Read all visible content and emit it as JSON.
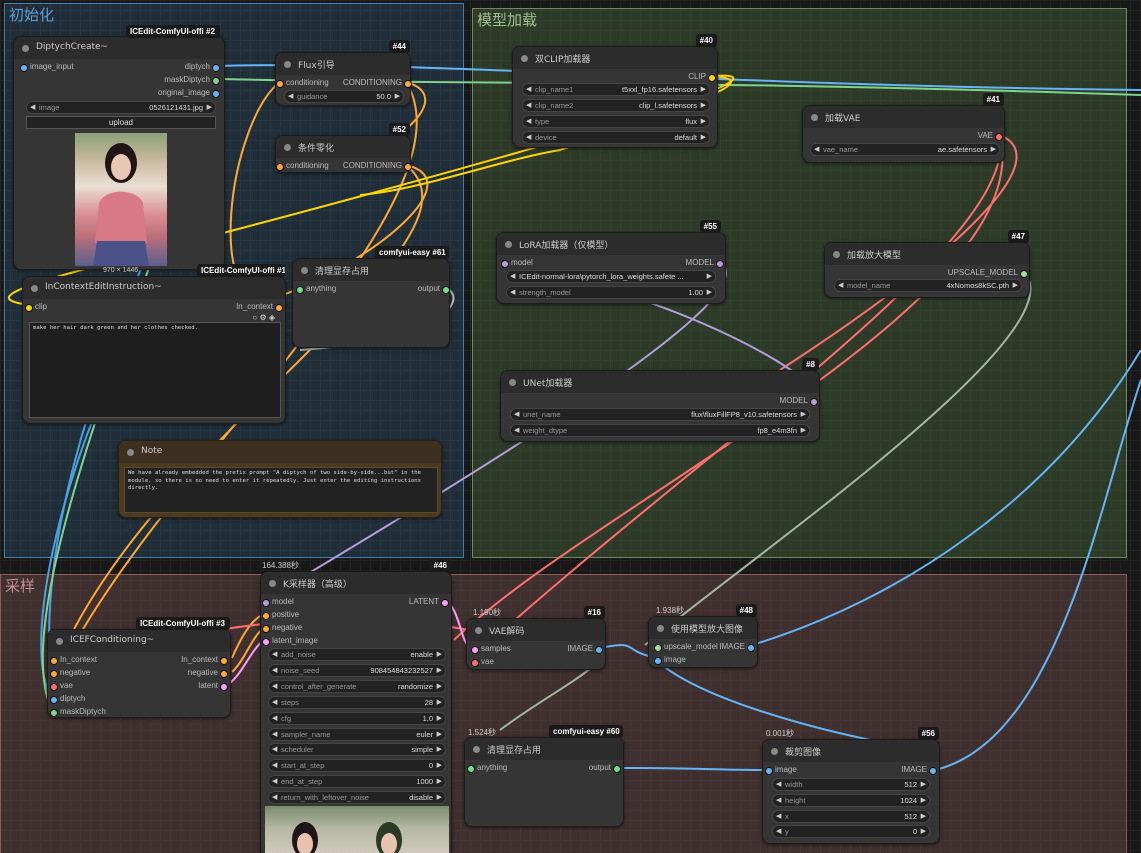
{
  "groups": {
    "init": {
      "title": "初始化",
      "color": "#3f7fb0",
      "bg": "rgba(50,90,120,0.35)"
    },
    "model": {
      "title": "模型加载",
      "color": "#6d8c5c",
      "bg": "rgba(70,100,60,0.45)"
    },
    "sample": {
      "title": "采样",
      "color": "#8c5a5a",
      "bg": "rgba(110,75,75,0.45)"
    }
  },
  "colors": {
    "conditioning": "#ffa931",
    "clip": "#ffd500",
    "model": "#b39ddb",
    "vae": "#ff6e6e",
    "image": "#64b5f6",
    "latent": "#ff9cf9",
    "any": "#aaaaaa"
  },
  "nodes": {
    "diptych": {
      "title": "DiptychCreate~",
      "badge": "ICEdit-ComfyUI-offi",
      "id": "#2",
      "in_image": "image_input",
      "out_diptych": "diptych",
      "out_mask": "maskDiptych",
      "out_original": "original_image",
      "image_label": "image",
      "image_value": "0526121431.jpg",
      "upload": "upload",
      "dims": "970 × 1446"
    },
    "flux": {
      "title": "Flux引导",
      "id": "#44",
      "in_cond": "conditioning",
      "out_cond": "CONDITIONING",
      "guidance_label": "guidance",
      "guidance_value": "50.0"
    },
    "zero": {
      "title": "条件零化",
      "id": "#52",
      "in_cond": "conditioning",
      "out_cond": "CONDITIONING"
    },
    "clear1": {
      "title": "清理显存占用",
      "badge": "comfyui-easy",
      "id": "#61",
      "in_any": "anything",
      "out": "output"
    },
    "iceinst": {
      "title": "InContextEditInstruction~",
      "badge": "ICEdit-ComfyUI-offi",
      "id": "#1",
      "in_clip": "clip",
      "out_ctx": "In_context",
      "prompt": "make her hair dark green and her clothes checked."
    },
    "note": {
      "title": "Note",
      "text": "We have already embedded the prefix prompt  \"A diptych of two side-by-side...but\"  in the module, so there is no need to enter it repeatedly. Just enter the editing instructions directly."
    },
    "dualclip": {
      "title": "双CLIP加载器",
      "id": "#40",
      "out_clip": "CLIP",
      "clip1_label": "clip_name1",
      "clip1_value": "t5xxl_fp16.safetensors",
      "clip2_label": "clip_name2",
      "clip2_value": "clip_l.safetensors",
      "type_label": "type",
      "type_value": "flux",
      "device_label": "device",
      "device_value": "default"
    },
    "vaeload": {
      "title": "加载VAE",
      "id": "#41",
      "out_vae": "VAE",
      "name_label": "vae_name",
      "name_value": "ae.safetensors"
    },
    "lora": {
      "title": "LoRA加载器（仅模型）",
      "id": "#55",
      "in_model": "model",
      "out_model": "MODEL",
      "lora_value": "ICEdit-normal-lora\\pytorch_lora_weights.safete ...",
      "strength_label": "strength_model",
      "strength_value": "1.00"
    },
    "upmodel": {
      "title": "加载放大模型",
      "id": "#47",
      "out": "UPSCALE_MODEL",
      "name_label": "model_name",
      "name_value": "4xNomos8kSC.pth"
    },
    "unet": {
      "title": "UNet加载器",
      "id": "#8",
      "out_model": "MODEL",
      "name_label": "unet_name",
      "name_value": "flux\\fluxFillFP8_v10.safetensors",
      "dtype_label": "weight_dtype",
      "dtype_value": "fp8_e4m3fn"
    },
    "ksampler": {
      "title": "K采样器（高级）",
      "id": "#46",
      "time": "164.388秒",
      "in_model": "model",
      "in_pos": "positive",
      "in_neg": "negative",
      "in_latent": "latent_image",
      "out_latent": "LATENT",
      "widgets": [
        {
          "label": "add_noise",
          "value": "enable"
        },
        {
          "label": "noise_seed",
          "value": "908454843232527"
        },
        {
          "label": "control_after_generate",
          "value": "randomize"
        },
        {
          "label": "steps",
          "value": "28"
        },
        {
          "label": "cfg",
          "value": "1.0"
        },
        {
          "label": "sampler_name",
          "value": "euler"
        },
        {
          "label": "scheduler",
          "value": "simple"
        },
        {
          "label": "start_at_step",
          "value": "0"
        },
        {
          "label": "end_at_step",
          "value": "1000"
        },
        {
          "label": "return_with_leftover_noise",
          "value": "disable"
        }
      ]
    },
    "icef": {
      "title": "ICEFConditioning~",
      "badge": "ICEdit-ComfyUI-offi",
      "id": "#3",
      "in_ctx": "In_context",
      "in_neg": "negative",
      "in_vae": "vae",
      "in_diptych": "diptych",
      "in_mask": "maskDiptych",
      "out_ctx": "In_context",
      "out_neg": "negative",
      "out_latent": "latent"
    },
    "vaedec": {
      "title": "VAE解码",
      "id": "#16",
      "time": "1.190秒",
      "in_samples": "samples",
      "in_vae": "vae",
      "out_image": "IMAGE"
    },
    "clear2": {
      "title": "清理显存占用",
      "badge": "comfyui-easy",
      "id": "#60",
      "time": "1.524秒",
      "in_any": "anything",
      "out": "output"
    },
    "upscale": {
      "title": "使用模型放大图像",
      "id": "#48",
      "time": "1.938秒",
      "in_model": "upscale_model",
      "in_image": "image",
      "out_image": "IMAGE"
    },
    "crop": {
      "title": "裁剪图像",
      "id": "#56",
      "time": "0.001秒",
      "in_image": "image",
      "out_image": "IMAGE",
      "widgets": [
        {
          "label": "width",
          "value": "512"
        },
        {
          "label": "height",
          "value": "1024"
        },
        {
          "label": "x",
          "value": "512"
        },
        {
          "label": "y",
          "value": "0"
        }
      ]
    }
  }
}
